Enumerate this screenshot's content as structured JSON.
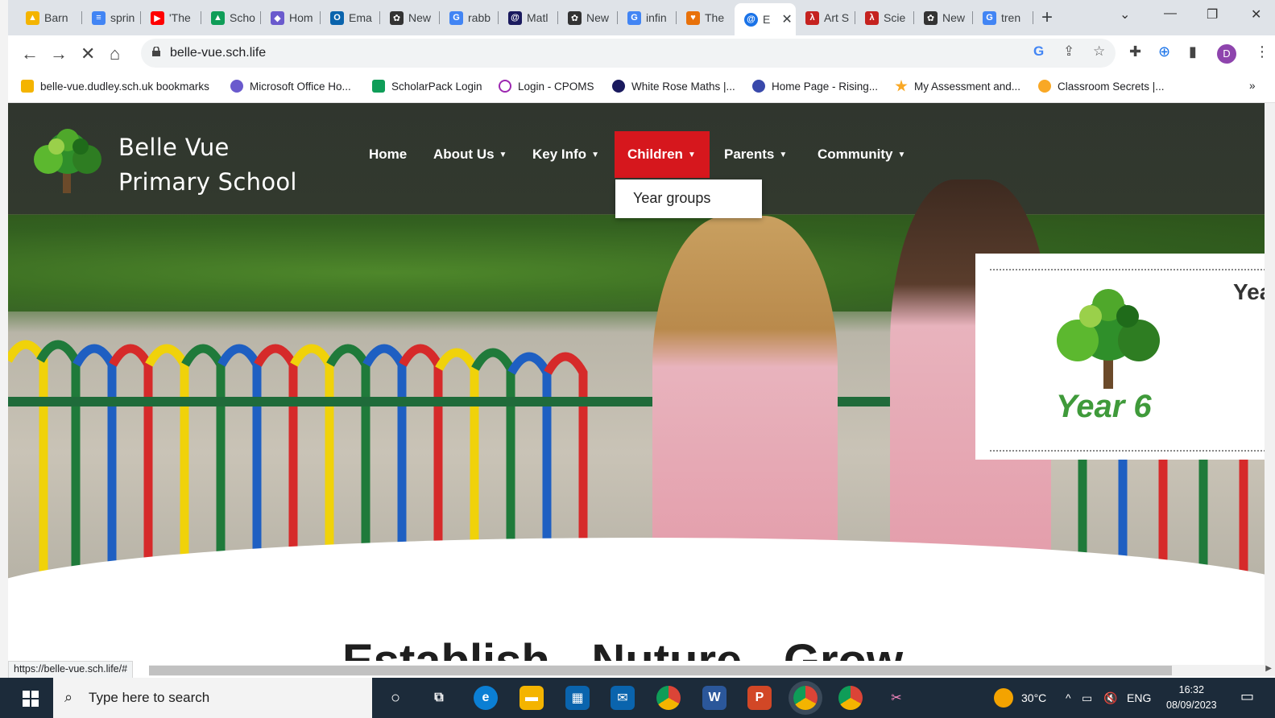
{
  "browser": {
    "tabs": [
      {
        "label": "Barn",
        "icon": "drive-icon",
        "color": "#f4b400"
      },
      {
        "label": "sprin",
        "icon": "docs-icon",
        "color": "#4285f4"
      },
      {
        "label": "'The",
        "icon": "youtube-icon",
        "color": "#ff0000"
      },
      {
        "label": "Scho",
        "icon": "drive-icon",
        "color": "#0f9d58"
      },
      {
        "label": "Hom",
        "icon": "office-icon",
        "color": "#6a5acd"
      },
      {
        "label": "Ema",
        "icon": "outlook-icon",
        "color": "#0a64ad"
      },
      {
        "label": "New",
        "icon": "chatgpt-icon",
        "color": "#333333"
      },
      {
        "label": "rabb",
        "icon": "google-icon",
        "color": "#4285f4"
      },
      {
        "label": "Matl",
        "icon": "whiterose-icon",
        "color": "#1a1a5e"
      },
      {
        "label": "New",
        "icon": "chatgpt-icon",
        "color": "#333333"
      },
      {
        "label": "infin",
        "icon": "google-icon",
        "color": "#4285f4"
      },
      {
        "label": "The",
        "icon": "heart-icon",
        "color": "#e8710a"
      },
      {
        "label": "E",
        "icon": "school-icon",
        "color": "#1a73e8",
        "active": true
      },
      {
        "label": "Art S",
        "icon": "pdf-icon",
        "color": "#c5221f"
      },
      {
        "label": "Scie",
        "icon": "pdf-icon",
        "color": "#c5221f"
      },
      {
        "label": "New",
        "icon": "chatgpt-icon",
        "color": "#333333"
      },
      {
        "label": "tren",
        "icon": "google-icon",
        "color": "#4285f4"
      }
    ],
    "new_tab": "+",
    "url": "belle-vue.sch.life",
    "profile_initial": "D",
    "bookmarks": [
      {
        "label": "belle-vue.dudley.sch.uk bookmarks",
        "color": "#f4b400"
      },
      {
        "label": "Microsoft Office Ho...",
        "color": "#6a5acd"
      },
      {
        "label": "ScholarPack Login",
        "color": "#0f9d58"
      },
      {
        "label": "Login - CPOMS",
        "color": "#9c27b0"
      },
      {
        "label": "White Rose Maths |...",
        "color": "#1a1a5e"
      },
      {
        "label": "Home Page - Rising...",
        "color": "#3949ab"
      },
      {
        "label": "My Assessment and...",
        "color": "#f9a825"
      },
      {
        "label": "Classroom Secrets |...",
        "color": "#f9a825"
      }
    ],
    "bookmarks_more": "»",
    "status_url": "https://belle-vue.sch.life/#"
  },
  "site": {
    "name_line1": "Belle Vue",
    "name_line2": "Primary School",
    "nav": [
      {
        "label": "Home",
        "has_caret": false
      },
      {
        "label": "About Us",
        "has_caret": true
      },
      {
        "label": "Key Info",
        "has_caret": true
      },
      {
        "label": "Children",
        "has_caret": true,
        "active": true
      },
      {
        "label": "Parents",
        "has_caret": true
      },
      {
        "label": "Community",
        "has_caret": true
      }
    ],
    "dropdown_item": "Year groups",
    "year_card_title": "Year 6",
    "year_card_partial": "Yea",
    "motto": "Establish - Nuture - Grow",
    "accent_color": "#d6171d"
  },
  "taskbar": {
    "search_placeholder": "Type here to search",
    "weather": "30°C",
    "language": "ENG",
    "time": "16:32",
    "date": "08/09/2023"
  }
}
